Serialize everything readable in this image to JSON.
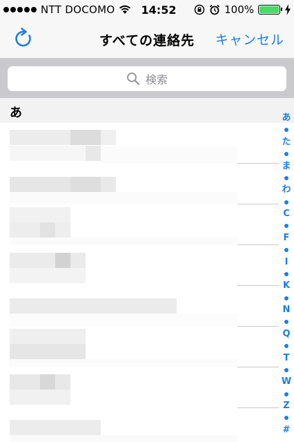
{
  "status_bar": {
    "carrier": "NTT DOCOMO",
    "time": "14:52",
    "battery": "100%",
    "battery_level": 1.0
  },
  "nav": {
    "title": "すべての連絡先",
    "cancel": "キャンセル"
  },
  "search": {
    "placeholder": "検索"
  },
  "section": {
    "title": "あ"
  },
  "contacts": [
    {
      "name": "",
      "subtitle": "",
      "blurred": true
    },
    {
      "name": "",
      "blurred": true
    },
    {
      "name": "",
      "subtitle": "",
      "blurred": true
    },
    {
      "name": "",
      "subtitle": "",
      "blurred": true
    },
    {
      "name": "",
      "blurred": true
    },
    {
      "name": "",
      "subtitle": "",
      "blurred": true
    },
    {
      "name": "",
      "subtitle": "",
      "blurred": true
    },
    {
      "name": "",
      "blurred": true
    }
  ],
  "index": [
    "あ",
    "た",
    "ま",
    "わ",
    "C",
    "F",
    "I",
    "K",
    "N",
    "Q",
    "T",
    "W",
    "Z",
    "#"
  ],
  "colors": {
    "accent": "#1a7ee8",
    "battery": "#4cd964"
  }
}
